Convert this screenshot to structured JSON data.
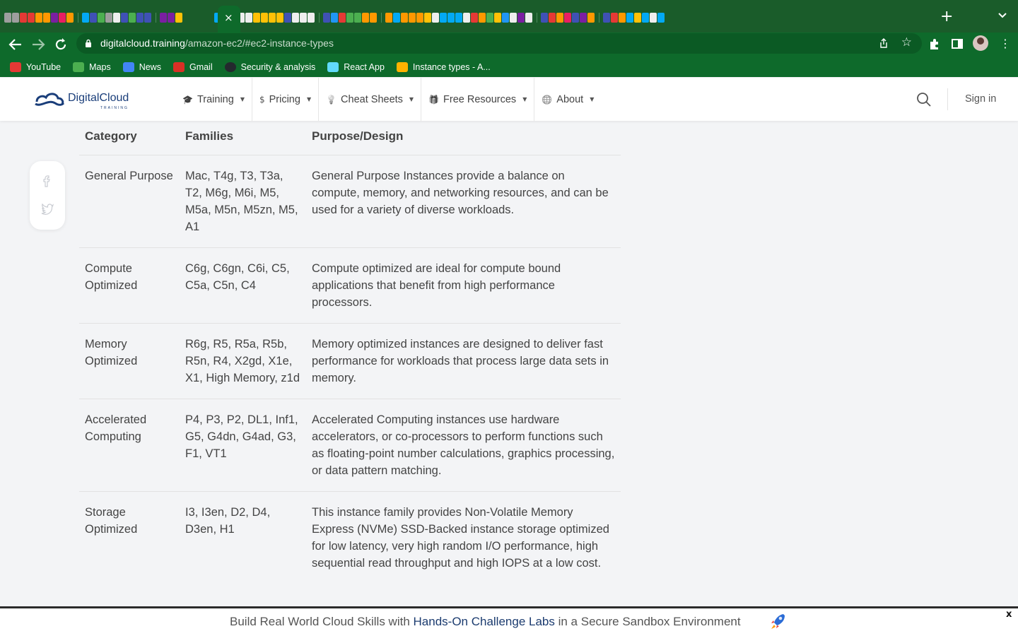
{
  "browser": {
    "active_tab_close": "×",
    "new_tab": "+",
    "url_domain": "digitalcloud.training",
    "url_path": "/amazon-ec2/#ec2-instance-types",
    "tab_favicon_colors": [
      "#9e9e9e",
      "#9e9e9e",
      "#e53935",
      "#e53935",
      "#ff9800",
      "#ff9800",
      "#7b1fa2",
      "#e91e63",
      "#ff9800",
      "#03a9f4",
      "#3f51b5",
      "#4caf50",
      "#9e9e9e",
      "#eeeeee",
      "#3f51b5",
      "#4caf50",
      "#3f51b5",
      "#3f51b5",
      "#7b1fa2",
      "#7b1fa2",
      "#ffc107",
      "#03a9f4",
      "#ffc107",
      "#ffc107",
      "#eeeeee",
      "#eeeeee",
      "#ffc107",
      "#ffc107",
      "#ffc107",
      "#ffc107",
      "#3f51b5",
      "#eeeeee",
      "#eeeeee",
      "#eeeeee",
      "#3f51b5",
      "#2196f3",
      "#e53935",
      "#4caf50",
      "#4caf50",
      "#ff9800",
      "#ff9800",
      "#ff9800",
      "#03a9f4",
      "#ff9800",
      "#ff9800",
      "#ff9800",
      "#ffc107",
      "#eeeeee",
      "#03a9f4",
      "#03a9f4",
      "#03a9f4",
      "#eeeeee",
      "#e53935",
      "#ff9800",
      "#4caf50",
      "#ffc107",
      "#2196f3",
      "#eeeeee",
      "#7b1fa2",
      "#eeeeee",
      "#3f51b5",
      "#e53935",
      "#ff9800",
      "#e91e63",
      "#3f51b5",
      "#7b1fa2",
      "#ff9800",
      "#3f51b5",
      "#e53935",
      "#ff9800",
      "#03a9f4",
      "#ffc107",
      "#03a9f4",
      "#eeeeee",
      "#03a9f4"
    ]
  },
  "bookmarks": [
    {
      "label": "YouTube",
      "icon": "youtube-icon",
      "color": "#e53935"
    },
    {
      "label": "Maps",
      "icon": "maps-icon",
      "color": "#4caf50"
    },
    {
      "label": "News",
      "icon": "news-icon",
      "color": "#4285f4"
    },
    {
      "label": "Gmail",
      "icon": "gmail-icon",
      "color": "#d93025"
    },
    {
      "label": "Security & analysis",
      "icon": "github-icon",
      "color": "#24292e"
    },
    {
      "label": "React App",
      "icon": "react-icon",
      "color": "#61dafb"
    },
    {
      "label": "Instance types - A...",
      "icon": "aws-cube-icon",
      "color": "#ffb300"
    }
  ],
  "site": {
    "logo_text": "DigitalCloud",
    "logo_sub": "TRAINING",
    "brand_color": "#1a3e7a",
    "nav": [
      {
        "label": "Training",
        "icon": "mortarboard-icon"
      },
      {
        "label": "Pricing",
        "icon": "dollar-icon"
      },
      {
        "label": "Cheat Sheets",
        "icon": "lightbulb-icon"
      },
      {
        "label": "Free Resources",
        "icon": "gift-icon"
      },
      {
        "label": "About",
        "icon": "globe-icon"
      }
    ],
    "sign_in": "Sign in"
  },
  "table": {
    "headers": [
      "Category",
      "Families",
      "Purpose/Design"
    ],
    "rows": [
      {
        "category": "General Purpose",
        "families": "Mac, T4g, T3, T3a, T2, M6g, M6i, M5, M5a, M5n, M5zn, M5, A1",
        "purpose": "General Purpose Instances provide a balance on compute, memory, and networking resources, and can be used for a variety of diverse workloads."
      },
      {
        "category": "Compute Optimized",
        "families": "C6g, C6gn, C6i, C5, C5a, C5n, C4",
        "purpose": "Compute optimized are ideal for compute bound applications that benefit from high performance processors."
      },
      {
        "category": "Memory Optimized",
        "families": "R6g, R5, R5a, R5b, R5n, R4, X2gd, X1e, X1, High Memory, z1d",
        "purpose": "Memory optimized instances are designed to deliver fast performance for workloads that process large data sets in memory."
      },
      {
        "category": "Accelerated Computing",
        "families": "P4, P3, P2, DL1, Inf1, G5, G4dn, G4ad, G3, F1, VT1",
        "purpose": "Accelerated Computing instances use hardware accelerators, or co-processors to perform functions such as floating-point number calculations, graphics processing, or data pattern matching."
      },
      {
        "category": "Storage Optimized",
        "families": "I3, I3en, D2, D4, D3en, H1",
        "purpose": "This instance family provides Non-Volatile Memory Express (NVMe) SSD-Backed instance storage optimized for low latency, very high random I/O performance, high sequential read throughput and high IOPS at a low cost."
      }
    ]
  },
  "promo": {
    "prefix": "Build Real World Cloud Skills with ",
    "highlight": "Hands-On Challenge Labs",
    "suffix": " in a Secure Sandbox Environment",
    "close": "x"
  }
}
